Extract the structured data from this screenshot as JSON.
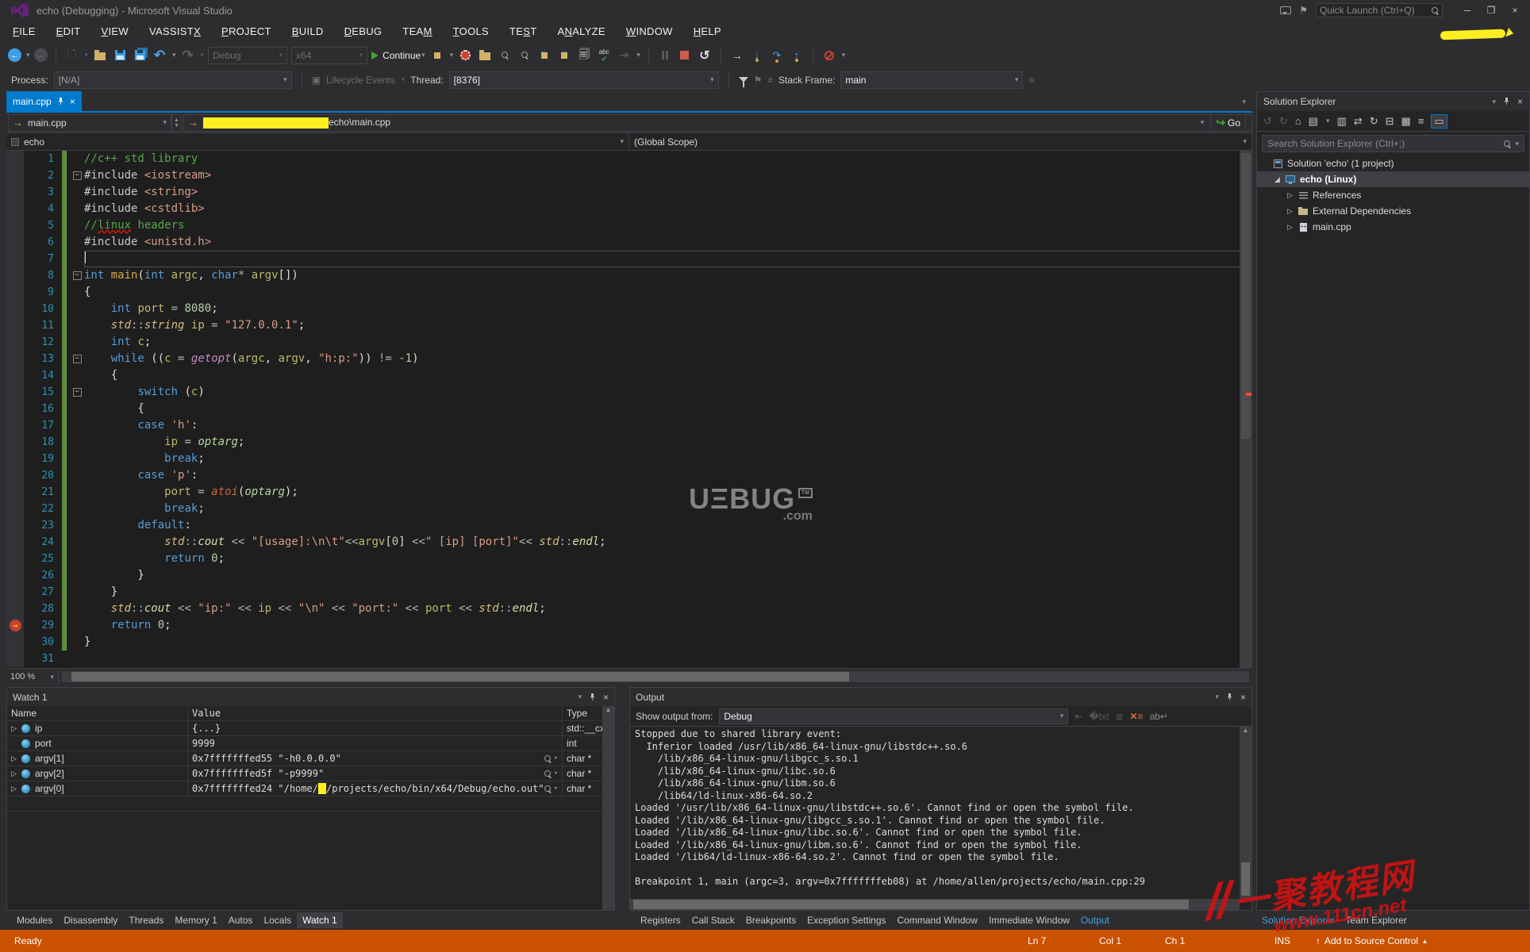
{
  "colors": {
    "accent": "#007ACC",
    "status_debug": "#CA5100",
    "editor_bg": "#1E1E1E",
    "chrome_bg": "#2D2D30",
    "breakpoint": "#C8402F",
    "change_bar": "#5B8A3C",
    "redaction": "#FCEE21"
  },
  "window": {
    "title": "echo (Debugging) - Microsoft Visual Studio",
    "quick_launch": "Quick Launch (Ctrl+Q)",
    "buttons": {
      "minimize": "─",
      "maximize": "❐",
      "close": "×"
    }
  },
  "menu": {
    "items": [
      {
        "pre": "",
        "u": "F",
        "post": "ILE"
      },
      {
        "pre": "",
        "u": "E",
        "post": "DIT"
      },
      {
        "pre": "",
        "u": "V",
        "post": "IEW"
      },
      {
        "pre": "VASSIST",
        "u": "X",
        "post": ""
      },
      {
        "pre": "",
        "u": "P",
        "post": "ROJECT"
      },
      {
        "pre": "",
        "u": "B",
        "post": "UILD"
      },
      {
        "pre": "",
        "u": "D",
        "post": "EBUG"
      },
      {
        "pre": "TEA",
        "u": "M",
        "post": ""
      },
      {
        "pre": "",
        "u": "T",
        "post": "OOLS"
      },
      {
        "pre": "TE",
        "u": "S",
        "post": "T"
      },
      {
        "pre": "A",
        "u": "N",
        "post": "ALYZE"
      },
      {
        "pre": "",
        "u": "W",
        "post": "INDOW"
      },
      {
        "pre": "",
        "u": "H",
        "post": "ELP"
      }
    ]
  },
  "toolbar": {
    "config": "Debug",
    "platform": "x64",
    "continue_label": "Continue"
  },
  "debugbar": {
    "process_label": "Process:",
    "process_value": "[N/A]",
    "lifecycle_label": "Lifecycle Events",
    "thread_label": "Thread:",
    "thread_value": "[8376]",
    "stackframe_label": "Stack Frame:",
    "stackframe_value": "main"
  },
  "editor": {
    "tab_label": "main.cpp",
    "nav_left": "main.cpp",
    "nav_path_suffix": "echo\\main.cpp",
    "scope_left": "echo",
    "scope_right": "(Global Scope)",
    "go_label": "Go",
    "zoom_level": "100 %",
    "lines": [
      {
        "n": 1,
        "chg": true,
        "segs": [
          [
            "//c++ std library",
            "c"
          ]
        ]
      },
      {
        "n": 2,
        "chg": true,
        "fold": true,
        "segs": [
          [
            "#include",
            "p"
          ],
          [
            " ",
            "t"
          ],
          [
            "<iostream>",
            "s"
          ]
        ]
      },
      {
        "n": 3,
        "chg": true,
        "segs": [
          [
            "#include",
            "p"
          ],
          [
            " ",
            "t"
          ],
          [
            "<string>",
            "s"
          ]
        ]
      },
      {
        "n": 4,
        "chg": true,
        "segs": [
          [
            "#include",
            "p"
          ],
          [
            " ",
            "t"
          ],
          [
            "<cstdlib>",
            "s"
          ]
        ]
      },
      {
        "n": 5,
        "chg": true,
        "segs": [
          [
            "//",
            "c"
          ],
          [
            "linux",
            "w"
          ],
          [
            " headers",
            "c"
          ]
        ]
      },
      {
        "n": 6,
        "chg": true,
        "segs": [
          [
            "#include",
            "p"
          ],
          [
            " ",
            "t"
          ],
          [
            "<unistd.h>",
            "s"
          ]
        ]
      },
      {
        "n": 7,
        "chg": true,
        "cur": true,
        "segs": []
      },
      {
        "n": 8,
        "chg": true,
        "fold": true,
        "segs": [
          [
            "int",
            "k"
          ],
          [
            " ",
            "t"
          ],
          [
            "main",
            "f"
          ],
          [
            "(",
            "t"
          ],
          [
            "int",
            "k"
          ],
          [
            " ",
            "t"
          ],
          [
            "argc",
            "v"
          ],
          [
            ", ",
            "t"
          ],
          [
            "char",
            "k"
          ],
          [
            "*",
            "o"
          ],
          [
            " ",
            "t"
          ],
          [
            "argv",
            "v"
          ],
          [
            "[])",
            "t"
          ]
        ]
      },
      {
        "n": 9,
        "chg": true,
        "segs": [
          [
            "{",
            "t"
          ]
        ]
      },
      {
        "n": 10,
        "chg": true,
        "segs": [
          [
            "    ",
            "t"
          ],
          [
            "int",
            "k"
          ],
          [
            " ",
            "t"
          ],
          [
            "port",
            "v"
          ],
          [
            " = ",
            "o"
          ],
          [
            "8080",
            "n"
          ],
          [
            ";",
            "t"
          ]
        ]
      },
      {
        "n": 11,
        "chg": true,
        "segs": [
          [
            "    ",
            "t"
          ],
          [
            "std",
            "y"
          ],
          [
            "::",
            "o"
          ],
          [
            "string",
            "y"
          ],
          [
            " ",
            "t"
          ],
          [
            "ip",
            "v"
          ],
          [
            " = ",
            "o"
          ],
          [
            "\"127.0.0.1\"",
            "s"
          ],
          [
            ";",
            "t"
          ]
        ]
      },
      {
        "n": 12,
        "chg": true,
        "segs": [
          [
            "    ",
            "t"
          ],
          [
            "int",
            "k"
          ],
          [
            " ",
            "t"
          ],
          [
            "c",
            "v"
          ],
          [
            ";",
            "t"
          ]
        ]
      },
      {
        "n": 13,
        "chg": true,
        "fold": true,
        "segs": [
          [
            "    ",
            "t"
          ],
          [
            "while",
            "k"
          ],
          [
            " ((",
            "t"
          ],
          [
            "c",
            "v"
          ],
          [
            " = ",
            "o"
          ],
          [
            "getopt",
            "g"
          ],
          [
            "(",
            "t"
          ],
          [
            "argc",
            "v"
          ],
          [
            ", ",
            "t"
          ],
          [
            "argv",
            "v"
          ],
          [
            ", ",
            "t"
          ],
          [
            "\"h:p:\"",
            "s"
          ],
          [
            ")) ",
            "t"
          ],
          [
            "!= ",
            "o"
          ],
          [
            "-1",
            "n"
          ],
          [
            ")",
            "t"
          ]
        ]
      },
      {
        "n": 14,
        "chg": true,
        "segs": [
          [
            "    {",
            "t"
          ]
        ]
      },
      {
        "n": 15,
        "chg": true,
        "fold": true,
        "segs": [
          [
            "        ",
            "t"
          ],
          [
            "switch",
            "k"
          ],
          [
            " (",
            "t"
          ],
          [
            "c",
            "v"
          ],
          [
            ")",
            "t"
          ]
        ]
      },
      {
        "n": 16,
        "chg": true,
        "segs": [
          [
            "        {",
            "t"
          ]
        ]
      },
      {
        "n": 17,
        "chg": true,
        "segs": [
          [
            "        ",
            "t"
          ],
          [
            "case",
            "k"
          ],
          [
            " ",
            "t"
          ],
          [
            "'h'",
            "s"
          ],
          [
            ":",
            "t"
          ]
        ]
      },
      {
        "n": 18,
        "chg": true,
        "segs": [
          [
            "            ",
            "t"
          ],
          [
            "ip",
            "v"
          ],
          [
            " = ",
            "o"
          ],
          [
            "optarg",
            "q"
          ],
          [
            ";",
            "t"
          ]
        ]
      },
      {
        "n": 19,
        "chg": true,
        "segs": [
          [
            "            ",
            "t"
          ],
          [
            "break",
            "k"
          ],
          [
            ";",
            "t"
          ]
        ]
      },
      {
        "n": 20,
        "chg": true,
        "segs": [
          [
            "        ",
            "t"
          ],
          [
            "case",
            "k"
          ],
          [
            " ",
            "t"
          ],
          [
            "'p'",
            "s"
          ],
          [
            ":",
            "t"
          ]
        ]
      },
      {
        "n": 21,
        "chg": true,
        "segs": [
          [
            "            ",
            "t"
          ],
          [
            "port",
            "v"
          ],
          [
            " = ",
            "o"
          ],
          [
            "atoi",
            "a"
          ],
          [
            "(",
            "t"
          ],
          [
            "optarg",
            "q"
          ],
          [
            ");",
            "t"
          ]
        ]
      },
      {
        "n": 22,
        "chg": true,
        "segs": [
          [
            "            ",
            "t"
          ],
          [
            "break",
            "k"
          ],
          [
            ";",
            "t"
          ]
        ]
      },
      {
        "n": 23,
        "chg": true,
        "segs": [
          [
            "        ",
            "t"
          ],
          [
            "default",
            "k"
          ],
          [
            ":",
            "t"
          ]
        ]
      },
      {
        "n": 24,
        "chg": true,
        "segs": [
          [
            "            ",
            "t"
          ],
          [
            "std",
            "y"
          ],
          [
            "::",
            "o"
          ],
          [
            "cout",
            "m"
          ],
          [
            " << ",
            "o"
          ],
          [
            "\"[usage]:\\n\\t\"",
            "s"
          ],
          [
            "<<",
            "o"
          ],
          [
            "argv",
            "v"
          ],
          [
            "[",
            "t"
          ],
          [
            "0",
            "n"
          ],
          [
            "] ",
            "t"
          ],
          [
            "<<",
            "o"
          ],
          [
            "\" [ip] [port]\"",
            "s"
          ],
          [
            "<< ",
            "o"
          ],
          [
            "std",
            "y"
          ],
          [
            "::",
            "o"
          ],
          [
            "endl",
            "m"
          ],
          [
            ";",
            "t"
          ]
        ]
      },
      {
        "n": 25,
        "chg": true,
        "segs": [
          [
            "            ",
            "t"
          ],
          [
            "return",
            "k"
          ],
          [
            " ",
            "t"
          ],
          [
            "0",
            "n"
          ],
          [
            ";",
            "t"
          ]
        ]
      },
      {
        "n": 26,
        "chg": true,
        "segs": [
          [
            "        }",
            "t"
          ]
        ]
      },
      {
        "n": 27,
        "chg": true,
        "segs": [
          [
            "    }",
            "t"
          ]
        ]
      },
      {
        "n": 28,
        "chg": true,
        "segs": [
          [
            "    ",
            "t"
          ],
          [
            "std",
            "y"
          ],
          [
            "::",
            "o"
          ],
          [
            "cout",
            "m"
          ],
          [
            " << ",
            "o"
          ],
          [
            "\"ip:\"",
            "s"
          ],
          [
            " << ",
            "o"
          ],
          [
            "ip",
            "v"
          ],
          [
            " << ",
            "o"
          ],
          [
            "\"\\n\"",
            "s"
          ],
          [
            " << ",
            "o"
          ],
          [
            "\"port:\"",
            "s"
          ],
          [
            " << ",
            "o"
          ],
          [
            "port",
            "v"
          ],
          [
            " << ",
            "o"
          ],
          [
            "std",
            "y"
          ],
          [
            "::",
            "o"
          ],
          [
            "endl",
            "m"
          ],
          [
            ";",
            "t"
          ]
        ]
      },
      {
        "n": 29,
        "chg": true,
        "bp": true,
        "segs": [
          [
            "    ",
            "t"
          ],
          [
            "return",
            "k"
          ],
          [
            " ",
            "t"
          ],
          [
            "0",
            "n"
          ],
          [
            ";",
            "t"
          ]
        ]
      },
      {
        "n": 30,
        "chg": true,
        "segs": [
          [
            "}",
            "t"
          ]
        ]
      },
      {
        "n": 31,
        "chg": false,
        "segs": []
      }
    ]
  },
  "watch": {
    "title": "Watch 1",
    "columns": [
      "Name",
      "Value",
      "Type"
    ],
    "rows": [
      {
        "arrow": true,
        "name": "ip",
        "parts": [
          [
            "{...}",
            "v"
          ]
        ],
        "type": "std::__cx",
        "mag": false
      },
      {
        "arrow": false,
        "name": "port",
        "parts": [
          [
            "9999",
            "v"
          ]
        ],
        "type": "int",
        "mag": false
      },
      {
        "arrow": true,
        "name": "argv[1]",
        "parts": [
          [
            "0x7fffffffed55 \"-h0.0.0.0\"",
            "v"
          ]
        ],
        "type": "char *",
        "mag": true
      },
      {
        "arrow": true,
        "name": "argv[2]",
        "parts": [
          [
            "0x7fffffffed5f \"-p9999\"",
            "v"
          ]
        ],
        "type": "char *",
        "mag": true
      },
      {
        "arrow": true,
        "name": "argv[0]",
        "parts": [
          [
            "0x7fffffffed24 \"/home/",
            "v"
          ],
          [
            "",
            "redact"
          ],
          [
            "/projects/echo/bin/x64/Debug/echo.out\"",
            "v"
          ]
        ],
        "type": "char *",
        "mag": true
      }
    ]
  },
  "output": {
    "title": "Output",
    "from_label": "Show output from:",
    "source": "Debug",
    "lines": [
      "Stopped due to shared library event:",
      "  Inferior loaded /usr/lib/x86_64-linux-gnu/libstdc++.so.6",
      "    /lib/x86_64-linux-gnu/libgcc_s.so.1",
      "    /lib/x86_64-linux-gnu/libc.so.6",
      "    /lib/x86_64-linux-gnu/libm.so.6",
      "    /lib64/ld-linux-x86-64.so.2",
      "Loaded '/usr/lib/x86_64-linux-gnu/libstdc++.so.6'. Cannot find or open the symbol file.",
      "Loaded '/lib/x86_64-linux-gnu/libgcc_s.so.1'. Cannot find or open the symbol file.",
      "Loaded '/lib/x86_64-linux-gnu/libc.so.6'. Cannot find or open the symbol file.",
      "Loaded '/lib/x86_64-linux-gnu/libm.so.6'. Cannot find or open the symbol file.",
      "Loaded '/lib64/ld-linux-x86-64.so.2'. Cannot find or open the symbol file.",
      "",
      "Breakpoint 1, main (argc=3, argv=0x7fffffffeb08) at /home/allen/projects/echo/main.cpp:29"
    ]
  },
  "solution_explorer": {
    "title": "Solution Explorer",
    "search_placeholder": "Search Solution Explorer (Ctrl+;)",
    "items": [
      {
        "label": "Solution 'echo' (1 project)",
        "icon": "solution",
        "indent": 0,
        "arrow": "none",
        "selected": false
      },
      {
        "label": "echo (Linux)",
        "icon": "monitor",
        "indent": 1,
        "arrow": "expanded",
        "selected": true
      },
      {
        "label": "References",
        "icon": "refs",
        "indent": 2,
        "arrow": "collapsed",
        "selected": false
      },
      {
        "label": "External Dependencies",
        "icon": "folder",
        "indent": 2,
        "arrow": "collapsed",
        "selected": false
      },
      {
        "label": "main.cpp",
        "icon": "doc",
        "indent": 2,
        "arrow": "collapsed",
        "selected": false
      }
    ]
  },
  "bottom_tabs": {
    "left": {
      "items": [
        "Modules",
        "Disassembly",
        "Threads",
        "Memory 1",
        "Autos",
        "Locals",
        "Watch 1"
      ],
      "active": "Watch 1"
    },
    "right": {
      "items": [
        "Registers",
        "Call Stack",
        "Breakpoints",
        "Exception Settings",
        "Command Window",
        "Immediate Window",
        "Output"
      ],
      "active": "Output"
    },
    "panel": {
      "items": [
        "Solution Explorer",
        "Team Explorer"
      ],
      "active": "Solution Explorer"
    }
  },
  "statusbar": {
    "state": "Ready",
    "ln": "Ln 7",
    "col": "Col 1",
    "ch": "Ch 1",
    "mode": "INS",
    "source_control": "Add to Source Control",
    "source_control_arrow": "↑"
  },
  "watermarks": {
    "editor_brand": "UΞBUG",
    "editor_tm": "TM",
    "editor_tld": ".com",
    "corner_line1": "一聚教程网",
    "corner_line2": "www.111cn.net"
  }
}
